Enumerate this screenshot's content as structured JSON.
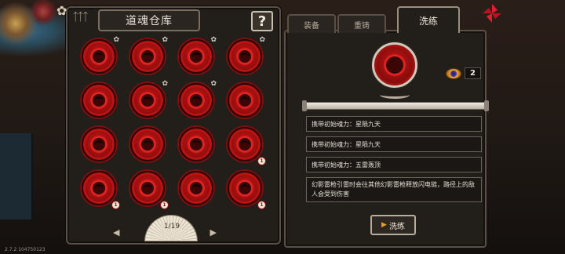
{
  "left_panel": {
    "title": "道魂仓库",
    "help_label": "?",
    "souls": [
      {
        "star": true,
        "level": ""
      },
      {
        "star": true,
        "level": ""
      },
      {
        "star": true,
        "level": ""
      },
      {
        "star": true,
        "level": ""
      },
      {
        "star": false,
        "level": ""
      },
      {
        "star": true,
        "level": ""
      },
      {
        "star": true,
        "level": ""
      },
      {
        "star": false,
        "level": ""
      },
      {
        "star": false,
        "level": ""
      },
      {
        "star": false,
        "level": ""
      },
      {
        "star": false,
        "level": ""
      },
      {
        "star": false,
        "level": "1"
      },
      {
        "star": false,
        "level": "1"
      },
      {
        "star": false,
        "level": "1"
      },
      {
        "star": false,
        "level": ""
      },
      {
        "star": false,
        "level": "1"
      }
    ],
    "pager": {
      "text": "1/19",
      "prev_label": "◀",
      "next_label": "▶"
    }
  },
  "right_panel": {
    "tabs": [
      {
        "label": "装备",
        "active": false
      },
      {
        "label": "重铸",
        "active": false
      },
      {
        "label": "洗练",
        "active": true
      }
    ],
    "item": {
      "name": "eye-of-demon",
      "count": "2"
    },
    "attributes": [
      "携带初始魂力：星陨九天",
      "携带初始魂力：星陨九天",
      "携带初始魂力：五雷轰顶"
    ],
    "description": "幻影雷枪引雷时会往其他幻影雷枪释放闪电链，路径上的敌人会受到伤害",
    "refine_button": "洗练"
  },
  "version": "2.7.2 104750123",
  "colors": {
    "soul_red": "#c81818",
    "panel_bg": "#221e1a",
    "border": "#5a5046"
  }
}
